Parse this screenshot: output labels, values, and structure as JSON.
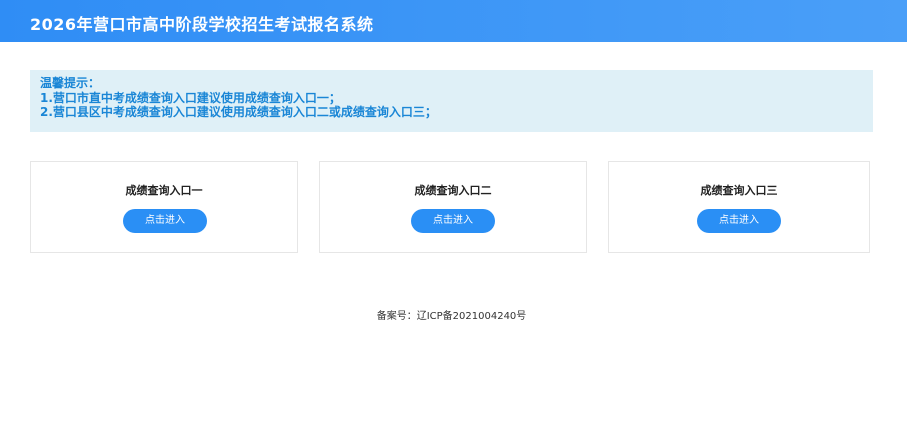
{
  "header": {
    "title": "2026年营口市高中阶段学校招生考试报名系统"
  },
  "notice": {
    "heading": "温馨提示：",
    "lines": [
      "1.营口市直中考成绩查询入口建议使用成绩查询入口一；",
      "2.营口县区中考成绩查询入口建议使用成绩查询入口二或成绩查询入口三；"
    ]
  },
  "cards": [
    {
      "title": "成绩查询入口一",
      "button": "点击进入"
    },
    {
      "title": "成绩查询入口二",
      "button": "点击进入"
    },
    {
      "title": "成绩查询入口三",
      "button": "点击进入"
    }
  ],
  "footer": {
    "icp": "备案号：辽ICP备2021004240号"
  },
  "colors": {
    "header_bg": "#3a95f6",
    "notice_bg": "#dff0f7",
    "notice_text": "#1a86d6",
    "button_bg": "#2a8ff5"
  }
}
